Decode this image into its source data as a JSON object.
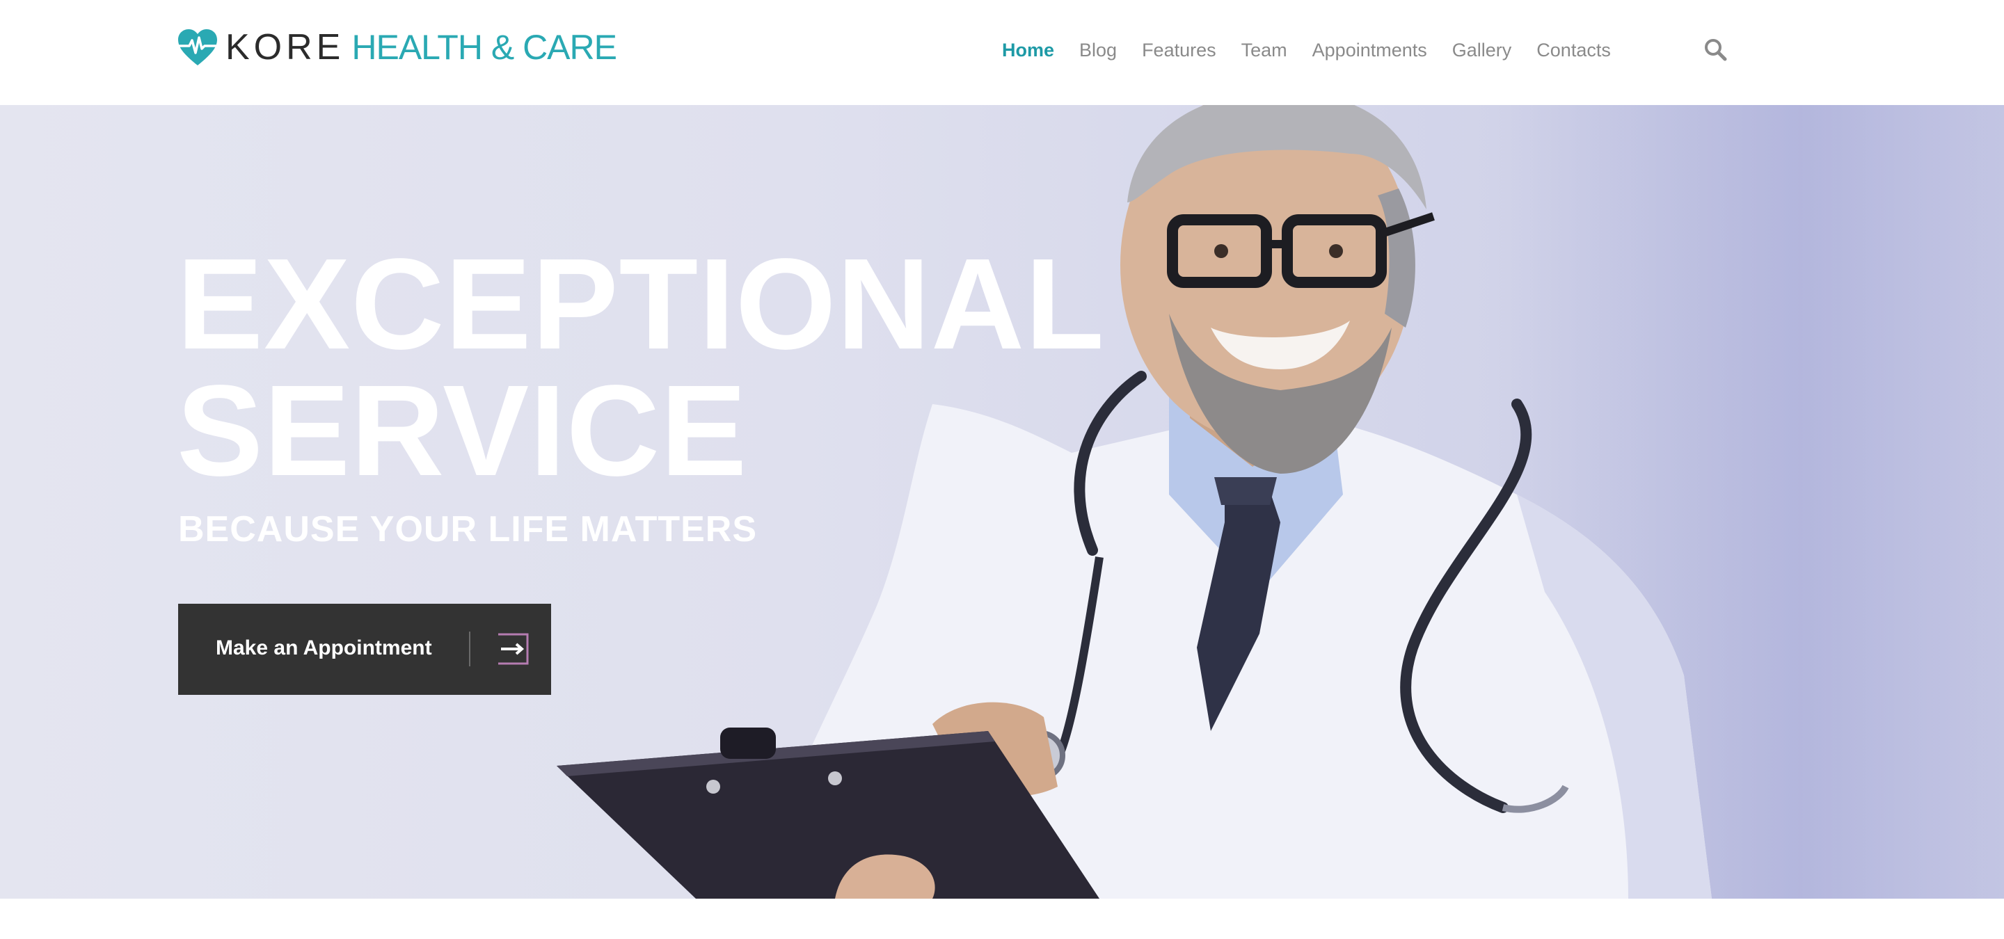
{
  "brand": {
    "name_part1": "KORE",
    "name_part2": "HEALTH & CARE",
    "accent_color": "#2aa9b3",
    "logo_icon": "heart-pulse-icon"
  },
  "nav": {
    "items": [
      {
        "label": "Home",
        "active": true
      },
      {
        "label": "Blog",
        "active": false
      },
      {
        "label": "Features",
        "active": false
      },
      {
        "label": "Team",
        "active": false
      },
      {
        "label": "Appointments",
        "active": false
      },
      {
        "label": "Gallery",
        "active": false
      },
      {
        "label": "Contacts",
        "active": false
      }
    ],
    "active_color": "#1e9aa6",
    "search_icon": "search-icon"
  },
  "hero": {
    "title_line1": "EXCEPTIONAL",
    "title_line2": "SERVICE",
    "subtitle": "BECAUSE YOUR LIFE MATTERS",
    "cta_label": "Make an Appointment",
    "cta_icon": "arrow-right-icon",
    "image_icon": "doctor-photo"
  }
}
